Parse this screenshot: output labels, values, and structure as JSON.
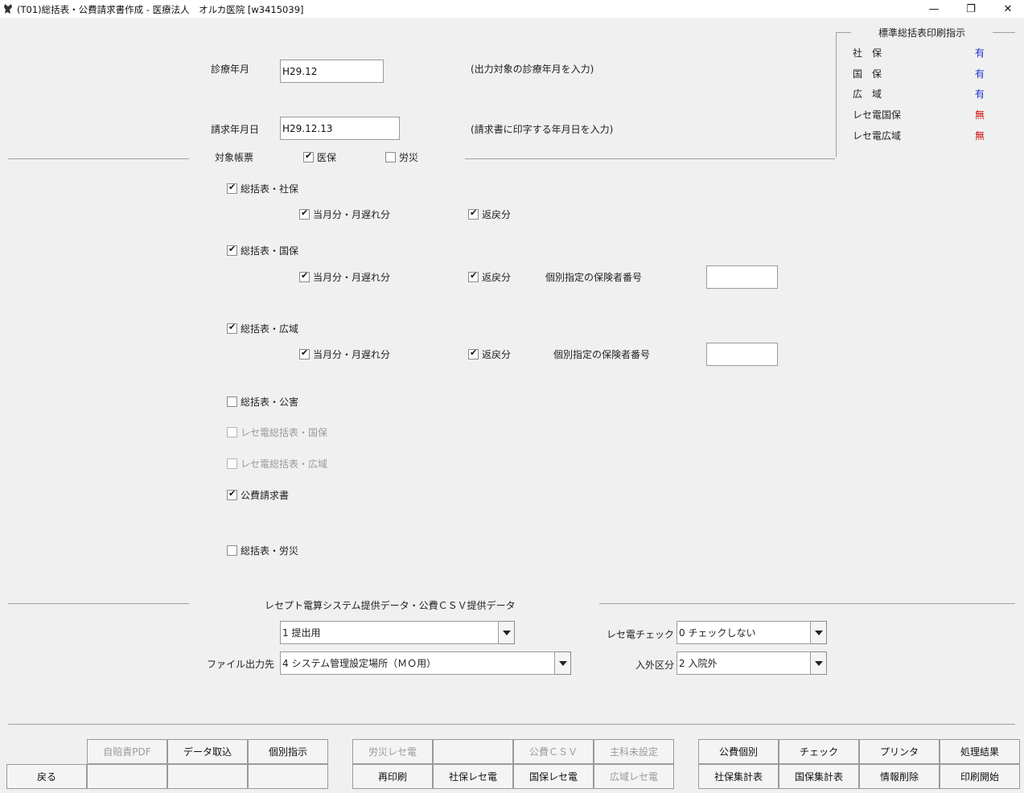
{
  "window": {
    "title": "(T01)総括表・公費請求書作成 - 医療法人　オルカ医院  [w3415039]",
    "minimize": "—",
    "maximize": "❐",
    "close": "✕"
  },
  "form": {
    "shinryo_label": "診療年月",
    "shinryo_value": "H29.12",
    "shinryo_hint": "(出力対象の診療年月を入力)",
    "seikyu_label": "請求年月日",
    "seikyu_value": "H29.12.13",
    "seikyu_hint": "(請求書に印字する年月日を入力)",
    "taisho_label": "対象帳票",
    "iho_label": "医保",
    "rosai_label": "労災"
  },
  "print_status": {
    "title": "標準総括表印刷指示",
    "rows": [
      {
        "label": "社　保",
        "value": "有",
        "color": "#1f2fd0"
      },
      {
        "label": "国　保",
        "value": "有",
        "color": "#1f2fd0"
      },
      {
        "label": "広　域",
        "value": "有",
        "color": "#1f2fd0"
      },
      {
        "label": "レセ電国保",
        "value": "無",
        "color": "#d01010"
      },
      {
        "label": "レセ電広域",
        "value": "無",
        "color": "#d01010"
      }
    ]
  },
  "options": {
    "shaho": "総括表・社保",
    "current_late": "当月分・月遅れ分",
    "henrei": "返戻分",
    "kokuho": "総括表・国保",
    "hokensha_label": "個別指定の保険者番号",
    "koiki": "総括表・広域",
    "kosho": "総括表・公害",
    "rece_kokuho": "レセ電総括表・国保",
    "rece_koiki": "レセ電総括表・広域",
    "kohi": "公費請求書",
    "rosai_sum": "総括表・労災"
  },
  "receipt": {
    "section_title": "レセプト電算システム提供データ・公費ＣＳＶ提供データ",
    "teishutsu_value": "1 提出用",
    "file_label": "ファイル出力先",
    "file_value": "4 システム管理設定場所（ＭＯ用）",
    "check_label": "レセ電チェック",
    "check_value": "0 チェックしない",
    "nyugai_label": "入外区分",
    "nyugai_value": "2 入院外"
  },
  "buttons": {
    "back": "戻る",
    "jibai_pdf": "自賠責PDF",
    "data_import": "データ取込",
    "kobetsu_shiji": "個別指示",
    "rosai_rece": "労災レセ電",
    "kohi_csv": "公費ＣＳＶ",
    "shuka_misettei": "主科未設定",
    "reprint": "再印刷",
    "shaho_rece": "社保レセ電",
    "kokuho_rece": "国保レセ電",
    "koiki_rece": "広域レセ電",
    "kohi_kobetsu": "公費個別",
    "check": "チェック",
    "printer": "プリンタ",
    "result": "処理結果",
    "shaho_shukei": "社保集計表",
    "kokuho_shukei": "国保集計表",
    "info_delete": "情報削除",
    "print_start": "印刷開始"
  }
}
